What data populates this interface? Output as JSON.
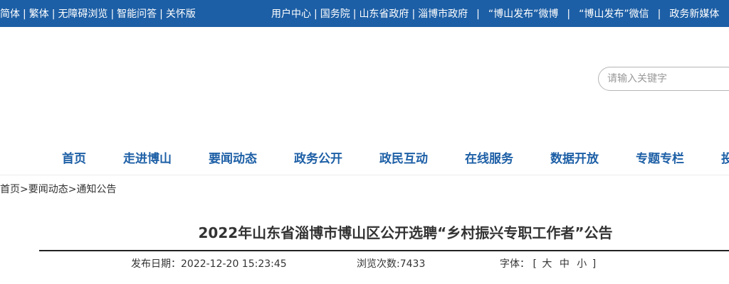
{
  "topbar": {
    "left_links": [
      "简体",
      "繁体",
      "无障碍浏览",
      "智能问答",
      "关怀版"
    ],
    "right_links": [
      "用户中心",
      "国务院",
      "山东省政府",
      "淄博市政府",
      "“博山发布”微博",
      "“博山发布”微信",
      "政务新媒体"
    ]
  },
  "search": {
    "placeholder": "请输入关键字"
  },
  "nav": {
    "items": [
      "首页",
      "走进博山",
      "要闻动态",
      "政务公开",
      "政民互动",
      "在线服务",
      "数据开放",
      "专题专栏",
      "投"
    ]
  },
  "breadcrumb": {
    "home": "首页",
    "sep": ">",
    "section": "要闻动态",
    "current": "通知公告"
  },
  "article": {
    "title": "2022年山东省淄博市博山区公开选聘“乡村振兴专职工作者”公告",
    "publish_label": "发布日期：",
    "publish_date": "2022-12-20 15:23:45",
    "views_label": "浏览次数:",
    "views": "7433",
    "font_label": "字体：",
    "font_open": "[",
    "font_large": "大",
    "font_medium": "中",
    "font_small": "小",
    "font_close": "]"
  },
  "colors": {
    "brand_blue": "#1d5fa6"
  }
}
